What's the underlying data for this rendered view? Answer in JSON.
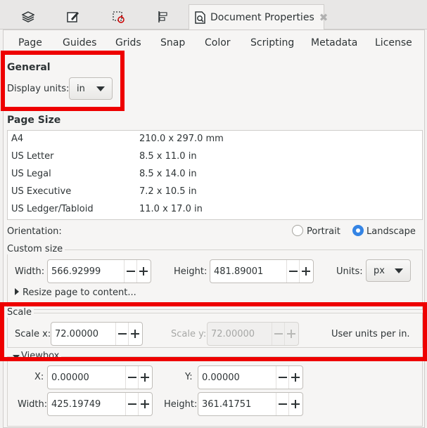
{
  "dock": {
    "tabs": [
      {
        "icon": "layers-icon"
      },
      {
        "icon": "fill-stroke-icon"
      },
      {
        "icon": "transform-icon"
      },
      {
        "icon": "align-distribute-icon"
      }
    ],
    "active_tab": {
      "title": "Document Properties",
      "icon": "document-properties-icon",
      "close": "✖"
    }
  },
  "subtabs": [
    "Page",
    "Guides",
    "Grids",
    "Snap",
    "Color",
    "Scripting",
    "Metadata",
    "License"
  ],
  "general": {
    "title": "General",
    "display_units_label": "Display units:",
    "display_units_value": "in"
  },
  "page_size": {
    "title": "Page Size",
    "rows": [
      {
        "name": "A4",
        "dims": "210.0 x 297.0 mm"
      },
      {
        "name": "US Letter",
        "dims": "8.5 x 11.0 in"
      },
      {
        "name": "US Legal",
        "dims": "8.5 x 14.0 in"
      },
      {
        "name": "US Executive",
        "dims": "7.2 x 10.5 in"
      },
      {
        "name": "US Ledger/Tabloid",
        "dims": "11.0 x 17.0 in"
      }
    ]
  },
  "orientation": {
    "label": "Orientation:",
    "portrait": "Portrait",
    "landscape": "Landscape",
    "selected": "Landscape"
  },
  "custom_size": {
    "title": "Custom size",
    "width_label": "Width:",
    "width_value": "566.92999",
    "height_label": "Height:",
    "height_value": "481.89001",
    "units_label": "Units:",
    "units_value": "px",
    "resize_label": "Resize page to content..."
  },
  "scale": {
    "title": "Scale",
    "scale_x_label": "Scale x:",
    "scale_x_value": "72.00000",
    "scale_y_label": "Scale y:",
    "scale_y_value": "72.00000",
    "units_note": "User units per in."
  },
  "viewbox": {
    "title": "Viewbox",
    "x_label": "X:",
    "x_value": "0.00000",
    "y_label": "Y:",
    "y_value": "0.00000",
    "width_label": "Width:",
    "width_value": "425.19749",
    "height_label": "Height:",
    "height_value": "361.41751"
  },
  "colors": {
    "highlight": "#ee0000",
    "accent": "#3584e4"
  }
}
